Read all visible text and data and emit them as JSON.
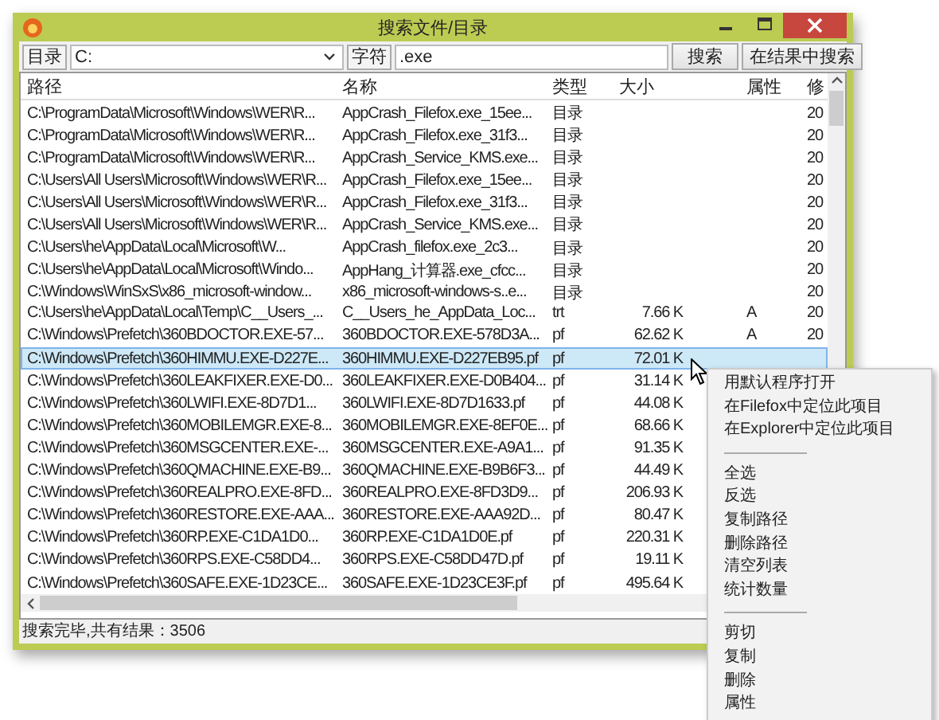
{
  "window": {
    "title": "搜索文件/目录"
  },
  "toolbar": {
    "dir_label": "目录",
    "dir_value": "C:",
    "pattern_label": "字符",
    "pattern_value": ".exe",
    "buttons": [
      "搜索",
      "在结果中搜索"
    ]
  },
  "table": {
    "columns": [
      "路径",
      "名称",
      "类型",
      "大小",
      "属性",
      "修"
    ],
    "rows": [
      {
        "path": "C:\\ProgramData\\Microsoft\\Windows\\WER\\R...",
        "name": "AppCrash_Filefox.exe_15ee...",
        "type": "目录",
        "date": "20",
        "selected": false
      },
      {
        "path": "C:\\ProgramData\\Microsoft\\Windows\\WER\\R...",
        "name": "AppCrash_Filefox.exe_31f3...",
        "type": "目录",
        "date": "20",
        "selected": false
      },
      {
        "path": "C:\\ProgramData\\Microsoft\\Windows\\WER\\R...",
        "name": "AppCrash_Service_KMS.exe...",
        "type": "目录",
        "date": "20",
        "selected": false
      },
      {
        "path": "C:\\Users\\All Users\\Microsoft\\Windows\\WER\\R...",
        "name": "AppCrash_Filefox.exe_15ee...",
        "type": "目录",
        "date": "20",
        "selected": false
      },
      {
        "path": "C:\\Users\\All Users\\Microsoft\\Windows\\WER\\R...",
        "name": "AppCrash_Filefox.exe_31f3...",
        "type": "目录",
        "date": "20",
        "selected": false
      },
      {
        "path": "C:\\Users\\All Users\\Microsoft\\Windows\\WER\\R...",
        "name": "AppCrash_Service_KMS.exe...",
        "type": "目录",
        "date": "20",
        "selected": false
      },
      {
        "path": "C:\\Users\\he\\AppData\\Local\\Microsoft\\W...",
        "name": "AppCrash_filefox.exe_2c3...",
        "type": "目录",
        "date": "20",
        "selected": false
      },
      {
        "path": "C:\\Users\\he\\AppData\\Local\\Microsoft\\Windo...",
        "name": "AppHang_计算器.exe_cfcc...",
        "type": "目录",
        "date": "20",
        "selected": false
      },
      {
        "path": "C:\\Windows\\WinSxS\\x86_microsoft-window...",
        "name": "x86_microsoft-windows-s..e...",
        "type": "目录",
        "date": "20",
        "selected": false
      },
      {
        "path": "C:\\Users\\he\\AppData\\Local\\Temp\\C__Users_...",
        "name": "C__Users_he_AppData_Loc...",
        "type": "trt",
        "size": "7.66 K",
        "attr": "A",
        "date": "20",
        "selected": false
      },
      {
        "path": "C:\\Windows\\Prefetch\\360BDOCTOR.EXE-57...",
        "name": "360BDOCTOR.EXE-578D3A...",
        "type": "pf",
        "size": "62.62 K",
        "attr": "A",
        "date": "20",
        "selected": false
      },
      {
        "path": "C:\\Windows\\Prefetch\\360HIMMU.EXE-D227E...",
        "name": "360HIMMU.EXE-D227EB95.pf",
        "type": "pf",
        "size": "72.01 K",
        "selected": true
      },
      {
        "path": "C:\\Windows\\Prefetch\\360LEAKFIXER.EXE-D0...",
        "name": "360LEAKFIXER.EXE-D0B404...",
        "type": "pf",
        "size": "31.14 K",
        "selected": false
      },
      {
        "path": "C:\\Windows\\Prefetch\\360LWIFI.EXE-8D7D1...",
        "name": "360LWIFI.EXE-8D7D1633.pf",
        "type": "pf",
        "size": "44.08 K",
        "selected": false
      },
      {
        "path": "C:\\Windows\\Prefetch\\360MOBILEMGR.EXE-8...",
        "name": "360MOBILEMGR.EXE-8EF0E...",
        "type": "pf",
        "size": "68.66 K",
        "selected": false
      },
      {
        "path": "C:\\Windows\\Prefetch\\360MSGCENTER.EXE-...",
        "name": "360MSGCENTER.EXE-A9A1...",
        "type": "pf",
        "size": "91.35 K",
        "selected": false
      },
      {
        "path": "C:\\Windows\\Prefetch\\360QMACHINE.EXE-B9...",
        "name": "360QMACHINE.EXE-B9B6F3...",
        "type": "pf",
        "size": "44.49 K",
        "selected": false
      },
      {
        "path": "C:\\Windows\\Prefetch\\360REALPRO.EXE-8FD...",
        "name": "360REALPRO.EXE-8FD3D9...",
        "type": "pf",
        "size": "206.93 K",
        "selected": false
      },
      {
        "path": "C:\\Windows\\Prefetch\\360RESTORE.EXE-AAA...",
        "name": "360RESTORE.EXE-AAA92D...",
        "type": "pf",
        "size": "80.47 K",
        "selected": false
      },
      {
        "path": "C:\\Windows\\Prefetch\\360RP.EXE-C1DA1D0...",
        "name": "360RP.EXE-C1DA1D0E.pf",
        "type": "pf",
        "size": "220.31 K",
        "selected": false
      },
      {
        "path": "C:\\Windows\\Prefetch\\360RPS.EXE-C58DD4...",
        "name": "360RPS.EXE-C58DD47D.pf",
        "type": "pf",
        "size": "19.11 K",
        "selected": false
      },
      {
        "path": "C:\\Windows\\Prefetch\\360SAFE.EXE-1D23CE...",
        "name": "360SAFE.EXE-1D23CE3F.pf",
        "type": "pf",
        "size": "495.64 K",
        "selected": false
      }
    ]
  },
  "status_bar": "搜索完毕,共有结果：3506",
  "context_menu": [
    {
      "kind": "item",
      "label": "用默认程序打开"
    },
    {
      "kind": "item",
      "label": "在Filefox中定位此项目"
    },
    {
      "kind": "item",
      "label": "在Explorer中定位此项目"
    },
    {
      "kind": "separator"
    },
    {
      "kind": "item",
      "label": "全选"
    },
    {
      "kind": "item",
      "label": "反选"
    },
    {
      "kind": "item",
      "label": "复制路径"
    },
    {
      "kind": "item",
      "label": "删除路径"
    },
    {
      "kind": "item",
      "label": "清空列表"
    },
    {
      "kind": "item",
      "label": "统计数量"
    },
    {
      "kind": "separator"
    },
    {
      "kind": "item",
      "label": "剪切"
    },
    {
      "kind": "item",
      "label": "复制"
    },
    {
      "kind": "item",
      "label": "删除"
    },
    {
      "kind": "item",
      "label": "属性"
    }
  ]
}
